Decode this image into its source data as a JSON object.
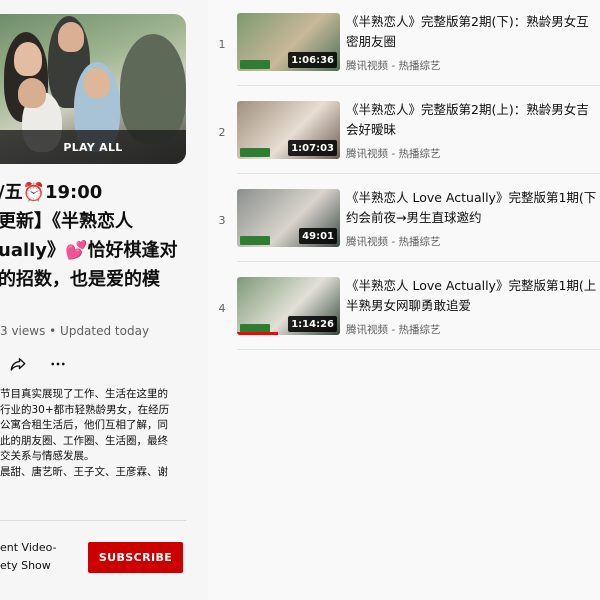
{
  "playlist": {
    "play_all_label": "PLAY ALL",
    "title_lines": [
      "/五⏰19:00",
      "更新】《半熟恋人",
      "ually》💕恰好棋逢对",
      "的招数，也是爱的模"
    ],
    "meta": "3 views • Updated today",
    "description_lines": [
      "节目真实展现了工作、生活在这里的",
      "行业的30+都市轻熟龄男女，在经历",
      "公寓合租生活后，他们互相了解，同",
      "此的朋友圈、工作圈、生活圈，最终",
      "交关系与情感发展。",
      "晨甜、唐艺昕、王子文、王彦霖、谢"
    ],
    "channel_lines": [
      "ent Video-",
      "ety Show"
    ],
    "subscribe_label": "SUBSCRIBE",
    "icons": [
      "share-icon",
      "more-icon"
    ]
  },
  "videos": [
    {
      "index": "1",
      "title_lines": [
        "《半熟恋人》完整版第2期(下)：熟龄男女互",
        "密朋友圈"
      ],
      "channel": "腾讯视频 - 热播综艺",
      "duration": "1:06:36",
      "thumb_colors": [
        "#7d9a6e",
        "#c8b89a",
        "#4e6f5a"
      ],
      "progress": 0
    },
    {
      "index": "2",
      "title_lines": [
        "《半熟恋人》完整版第2期(上)：熟龄男女吉",
        "会好暧昧"
      ],
      "channel": "腾讯视频 - 热播综艺",
      "duration": "1:07:03",
      "thumb_colors": [
        "#a08f7c",
        "#e7ddd2",
        "#6b5b4f"
      ],
      "progress": 0
    },
    {
      "index": "3",
      "title_lines": [
        "《半熟恋人 Love Actually》完整版第1期(下",
        "约会前夜→男生直球邀约"
      ],
      "channel": "腾讯视频 - 热播综艺",
      "duration": "49:01",
      "thumb_colors": [
        "#8a8f8c",
        "#d9d4cc",
        "#3d4844"
      ],
      "progress": 0
    },
    {
      "index": "4",
      "title_lines": [
        "《半熟恋人 Love Actually》完整版第1期(上",
        "半熟男女网聊勇敢追爱"
      ],
      "channel": "腾讯视频 - 热播综艺",
      "duration": "1:14:26",
      "thumb_colors": [
        "#7f9a7a",
        "#e2e0d6",
        "#34463a"
      ],
      "progress": 0.4
    }
  ],
  "colors": {
    "accent": "#cc0000",
    "progress": "#ff0000"
  }
}
